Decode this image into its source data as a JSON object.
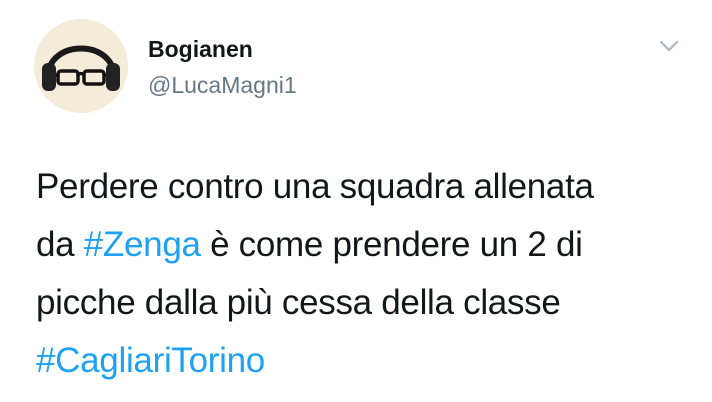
{
  "user": {
    "display_name": "Bogianen",
    "handle": "@LucaMagni1"
  },
  "menu_icon": "chevron-down-icon",
  "avatar_icon": "headphones-glasses-avatar",
  "tweet": {
    "line1": "Perdere contro una squadra allenata",
    "line2_prefix": "da ",
    "hashtag1": "#Zenga",
    "line2_suffix": " è come prendere un 2 di",
    "line3": "picche dalla più cessa della classe",
    "hashtag2": "#CagliariTorino"
  },
  "colors": {
    "hashtag": "#1da1f2",
    "handle": "#657786",
    "text": "#14171a",
    "avatar_bg": "#f4ecd8"
  }
}
